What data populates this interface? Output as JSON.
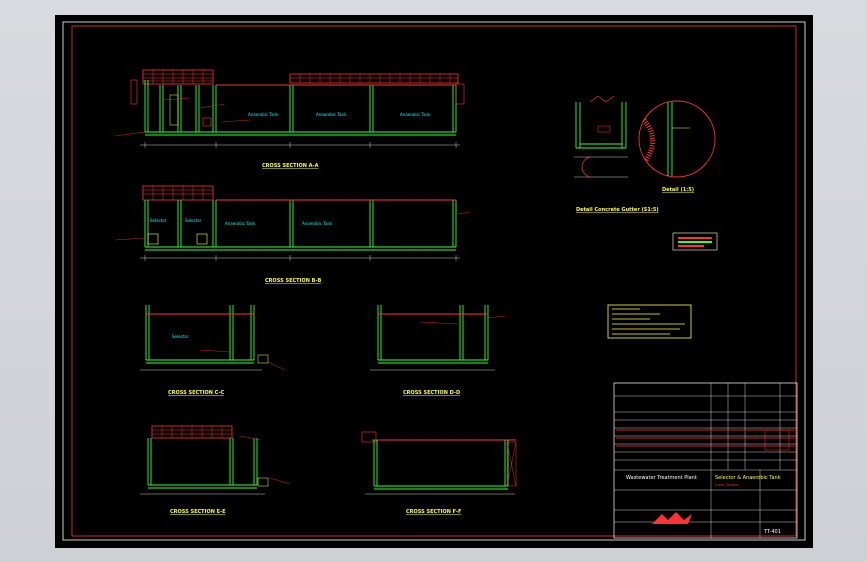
{
  "sections": [
    {
      "id": "a",
      "title": "CROSS SECTION A-A"
    },
    {
      "id": "b",
      "title": "CROSS SECTION B-B"
    },
    {
      "id": "c",
      "title": "CROSS SECTION C-C"
    },
    {
      "id": "d",
      "title": "CROSS SECTION D-D"
    },
    {
      "id": "e",
      "title": "CROSS SECTION E-E"
    },
    {
      "id": "f",
      "title": "CROSS SECTION F-F"
    }
  ],
  "tanks": {
    "selector": "Selector",
    "anaerobic": "Anaerobic Tank"
  },
  "details": {
    "gutter_title": "Detail Concrete Gutter (S1:5)",
    "detail_title": "Detail (1:5)"
  },
  "title_block": {
    "project": "Wastewater Treatment Plant",
    "drawing_title": "Selector & Anaerobic Tank",
    "drawing_subtitle": "Cross Section",
    "drawing_no": "TT-401"
  },
  "colors": {
    "background": "#000000",
    "wall": "#33ff33",
    "slab": "#ff3333",
    "text_cyan": "#00ffff",
    "text_yellow": "#ffff33",
    "frame": "#ffffff"
  }
}
